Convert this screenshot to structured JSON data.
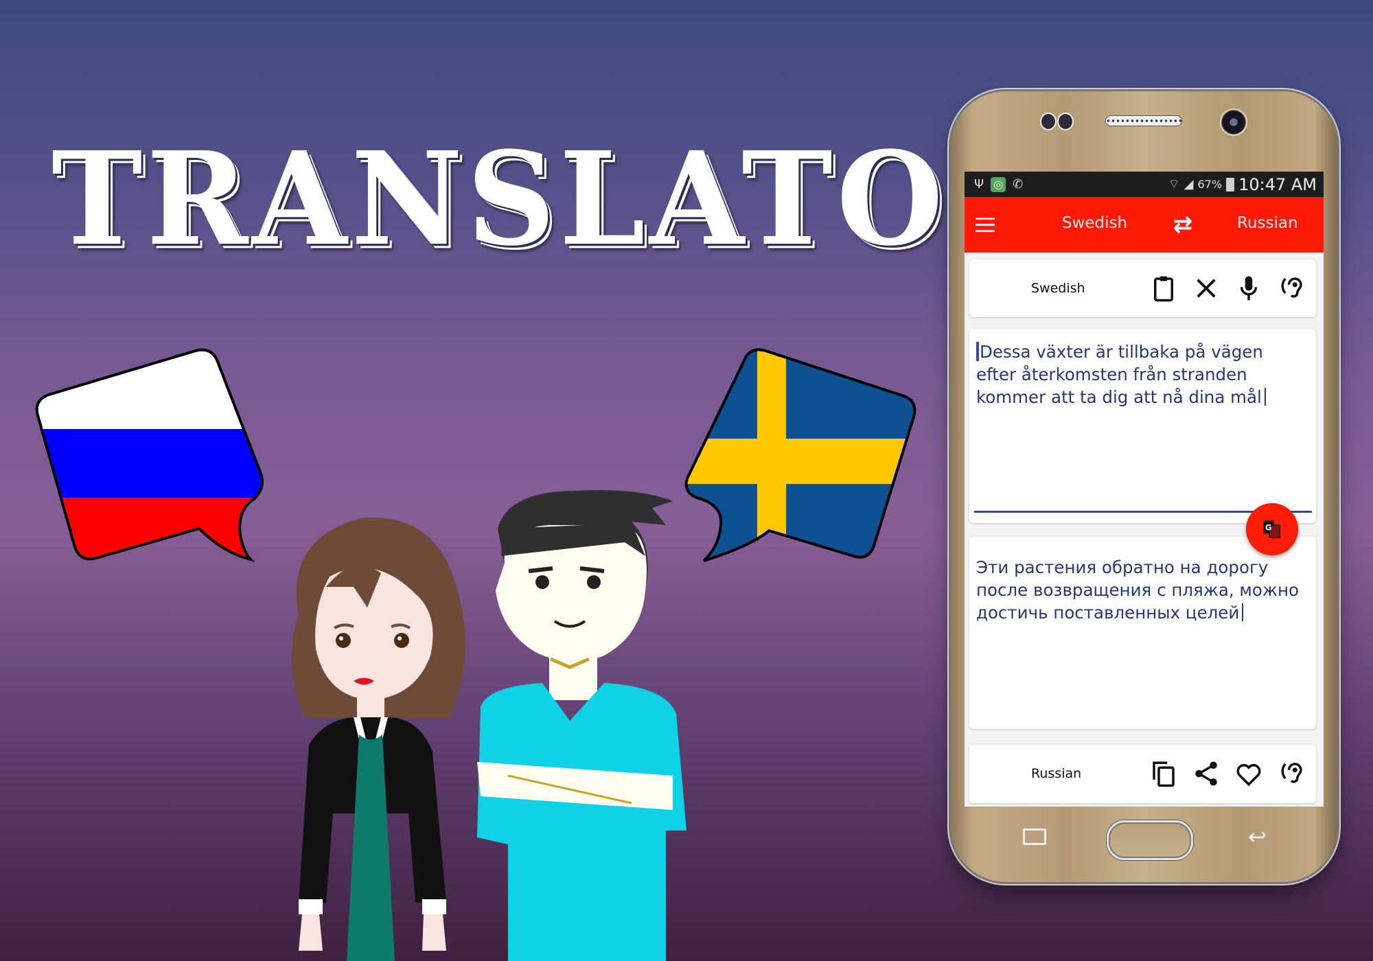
{
  "banner": {
    "title": "TRANSLATOR",
    "flag_left": {
      "country": "Russia",
      "colors": [
        "#ffffff",
        "#0000ff",
        "#ff0000"
      ]
    },
    "flag_right": {
      "country": "Sweden",
      "colors": [
        "#0e5193",
        "#ffc800"
      ]
    }
  },
  "status_bar": {
    "icons": [
      "usb-icon",
      "app-notification-icon",
      "missed-call-icon",
      "wifi-icon",
      "signal-icon",
      "battery-charging-icon"
    ],
    "battery": "67%",
    "time": "10:47 AM"
  },
  "toolbar": {
    "menu_icon": "hamburger-menu-icon",
    "source_language": "Swedish",
    "swap_icon": "swap-arrows-icon",
    "target_language": "Russian",
    "color": "#fe1a07"
  },
  "source_panel": {
    "label": "Swedish",
    "actions": [
      {
        "name": "paste",
        "icon": "clipboard-icon"
      },
      {
        "name": "clear",
        "icon": "close-icon"
      },
      {
        "name": "voice-input",
        "icon": "microphone-icon"
      },
      {
        "name": "listen",
        "icon": "hearing-icon"
      }
    ],
    "text": "Dessa växter är tillbaka på vägen efter återkomsten från stranden kommer att ta dig att nå dina mål"
  },
  "translate_button": {
    "icon": "google-translate-icon"
  },
  "target_panel": {
    "text": "Эти растения обратно на дорогу после возвращения с пляжа, можно достичь поставленных целей",
    "label": "Russian",
    "actions": [
      {
        "name": "copy",
        "icon": "copy-icon"
      },
      {
        "name": "share",
        "icon": "share-icon"
      },
      {
        "name": "favorite",
        "icon": "heart-icon"
      },
      {
        "name": "listen",
        "icon": "hearing-icon"
      }
    ]
  },
  "nav_bar": {
    "buttons": [
      "recent-apps",
      "home",
      "back"
    ]
  }
}
